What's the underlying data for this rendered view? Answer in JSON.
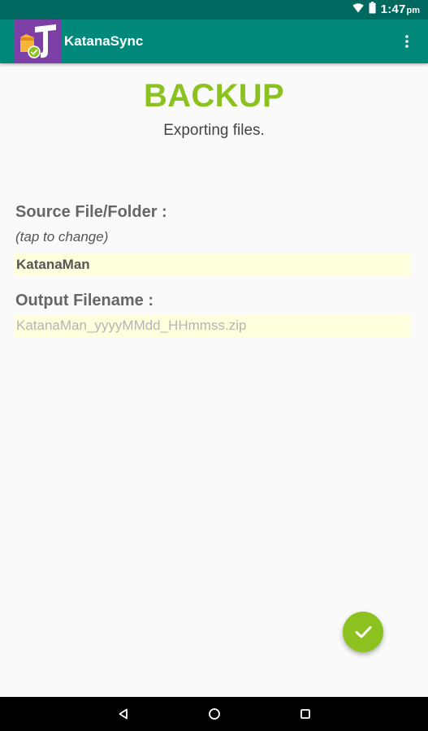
{
  "status_bar": {
    "time": "1:47",
    "ampm": "pm",
    "icons": [
      "wifi-icon",
      "battery-icon"
    ]
  },
  "app_bar": {
    "title": "KatanaSync",
    "logo_icon": "katana-logo-icon",
    "menu_icon": "overflow-menu-icon"
  },
  "header": {
    "title": "BACKUP",
    "subtitle": "Exporting files."
  },
  "source": {
    "label": "Source File/Folder :",
    "hint": "(tap to change)",
    "value": "KatanaMan"
  },
  "output": {
    "label": "Output Filename :",
    "value": "",
    "placeholder": "KatanaMan_yyyyMMdd_HHmmss.zip"
  },
  "fab": {
    "icon": "check-icon"
  },
  "nav_bar": {
    "icons": [
      "back-icon",
      "home-icon",
      "recents-icon"
    ]
  },
  "colors": {
    "status_bar": "#00695f",
    "app_bar": "#00897b",
    "accent": "#8cc21f",
    "field_background": "#ffffdd",
    "logo_purple": "#7b3fa6"
  }
}
